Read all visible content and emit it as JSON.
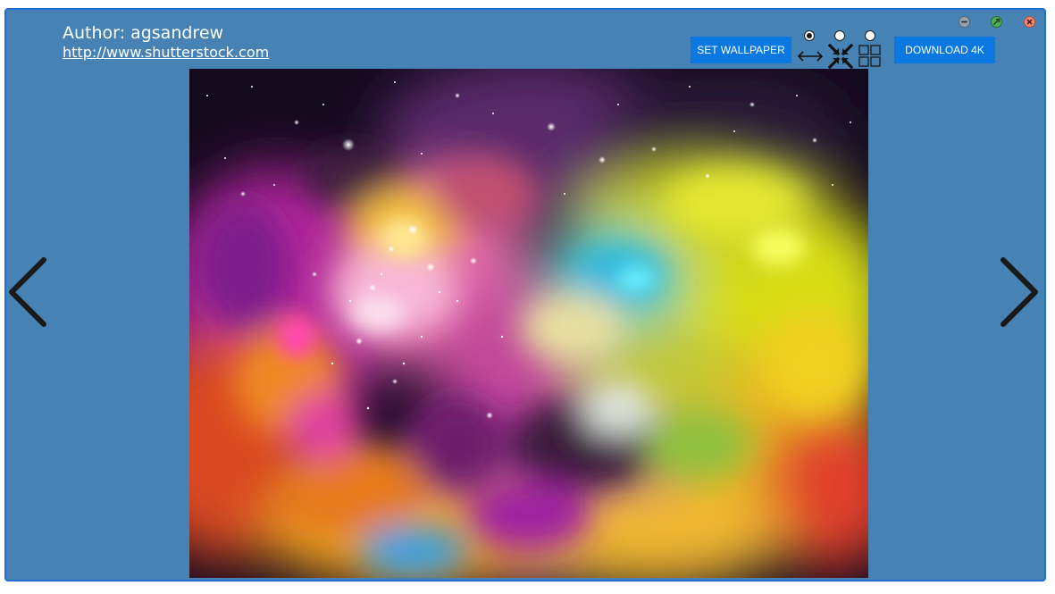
{
  "window": {
    "background_color": "#4682b4",
    "border_color": "#1f6fd1"
  },
  "header": {
    "author_text": "Author: agsandrew",
    "author_link": "http://www.shutterstock.com"
  },
  "toolbar": {
    "set_wallpaper_label": "SET WALLPAPER",
    "download_label": "DOWNLOAD 4K",
    "button_color": "#0a78e0",
    "display_modes": [
      {
        "icon": "stretch-horizontal-icon",
        "selected": true
      },
      {
        "icon": "fit-center-icon",
        "selected": false
      },
      {
        "icon": "tile-grid-icon",
        "selected": false
      }
    ]
  },
  "window_controls": [
    {
      "icon": "minimize-icon"
    },
    {
      "icon": "maximize-icon"
    },
    {
      "icon": "close-icon"
    }
  ],
  "image": {
    "description_icon": "colorful-nebula-image"
  },
  "navigation": {
    "prev_icon": "chevron-left-icon",
    "next_icon": "chevron-right-icon"
  }
}
